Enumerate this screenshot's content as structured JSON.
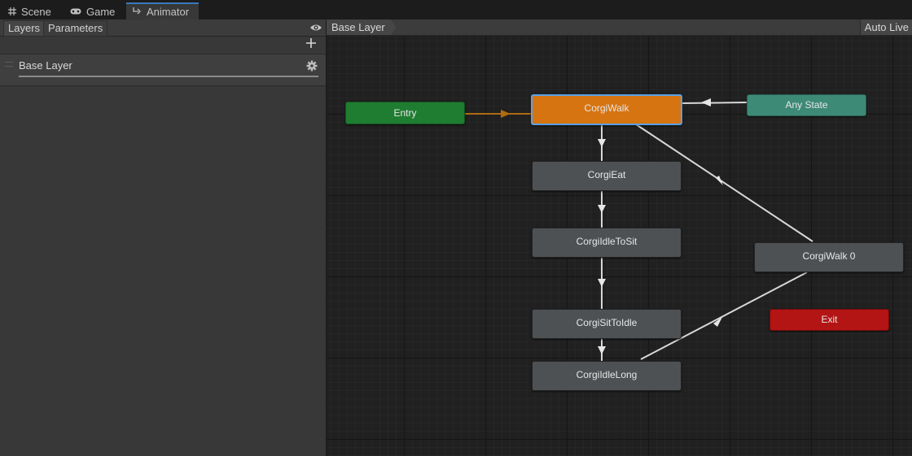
{
  "tabs": {
    "scene": "Scene",
    "game": "Game",
    "animator": "Animator"
  },
  "left_panel": {
    "tabs": [
      "Layers",
      "Parameters"
    ],
    "layers": [
      {
        "name": "Base Layer"
      }
    ]
  },
  "graph": {
    "breadcrumb": "Base Layer",
    "auto_live_link": "Auto Live",
    "states": {
      "entry": "Entry",
      "any_state": "Any State",
      "exit": "Exit",
      "corgi_walk": "CorgiWalk",
      "corgi_eat": "CorgiEat",
      "corgi_idle_to_sit": "CorgiIdleToSit",
      "corgi_sit_to_idle": "CorgiSitToIdle",
      "corgi_idle_long": "CorgiIdleLong",
      "corgi_walk_0": "CorgiWalk 0"
    },
    "default_state": "CorgiWalk",
    "transitions": [
      {
        "from": "Entry",
        "to": "CorgiWalk",
        "kind": "default"
      },
      {
        "from": "Any State",
        "to": "CorgiWalk"
      },
      {
        "from": "CorgiWalk",
        "to": "CorgiEat"
      },
      {
        "from": "CorgiEat",
        "to": "CorgiIdleToSit"
      },
      {
        "from": "CorgiIdleToSit",
        "to": "CorgiSitToIdle"
      },
      {
        "from": "CorgiSitToIdle",
        "to": "CorgiIdleLong"
      },
      {
        "from": "CorgiIdleLong",
        "to": "CorgiWalk 0"
      },
      {
        "from": "CorgiWalk 0",
        "to": "CorgiWalk"
      }
    ]
  },
  "colors": {
    "entry": "#1f7d32",
    "default_state": "#d67412",
    "selected_outline": "#5aa2e6",
    "any_state": "#3d8a76",
    "exit": "#b31414",
    "state": "#4e5154",
    "transition": "#d8d8d8",
    "default_transition": "#b06a10",
    "active_tab_accent": "#3a79bb"
  },
  "icons": {
    "scene": "grid-icon",
    "game": "gamepad-icon",
    "animator": "animator-icon",
    "visibility": "eye-icon",
    "add": "plus-icon",
    "settings": "gear-icon"
  }
}
